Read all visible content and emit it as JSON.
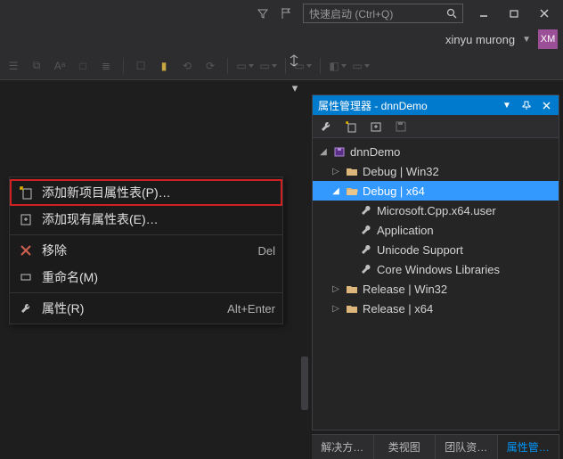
{
  "titlebar": {
    "quick_launch_placeholder": "快速启动 (Ctrl+Q)"
  },
  "user": {
    "name": "xinyu murong",
    "initials": "XM"
  },
  "property_manager": {
    "title": "属性管理器 - dnnDemo",
    "tree": {
      "root": "dnnDemo",
      "debug_win32": "Debug | Win32",
      "debug_x64": "Debug | x64",
      "debug_x64_children": {
        "ms_cpp_user": "Microsoft.Cpp.x64.user",
        "application": "Application",
        "unicode": "Unicode Support",
        "core_win": "Core Windows Libraries"
      },
      "release_win32": "Release | Win32",
      "release_x64": "Release | x64"
    }
  },
  "bottom_tabs": {
    "solution": "解决方…",
    "classview": "类视图",
    "team": "团队资…",
    "propmgr": "属性管…"
  },
  "context_menu": {
    "add_new": "添加新项目属性表(P)…",
    "add_existing": "添加现有属性表(E)…",
    "remove": "移除",
    "remove_shortcut": "Del",
    "rename": "重命名(M)",
    "properties": "属性(R)",
    "properties_shortcut": "Alt+Enter"
  }
}
